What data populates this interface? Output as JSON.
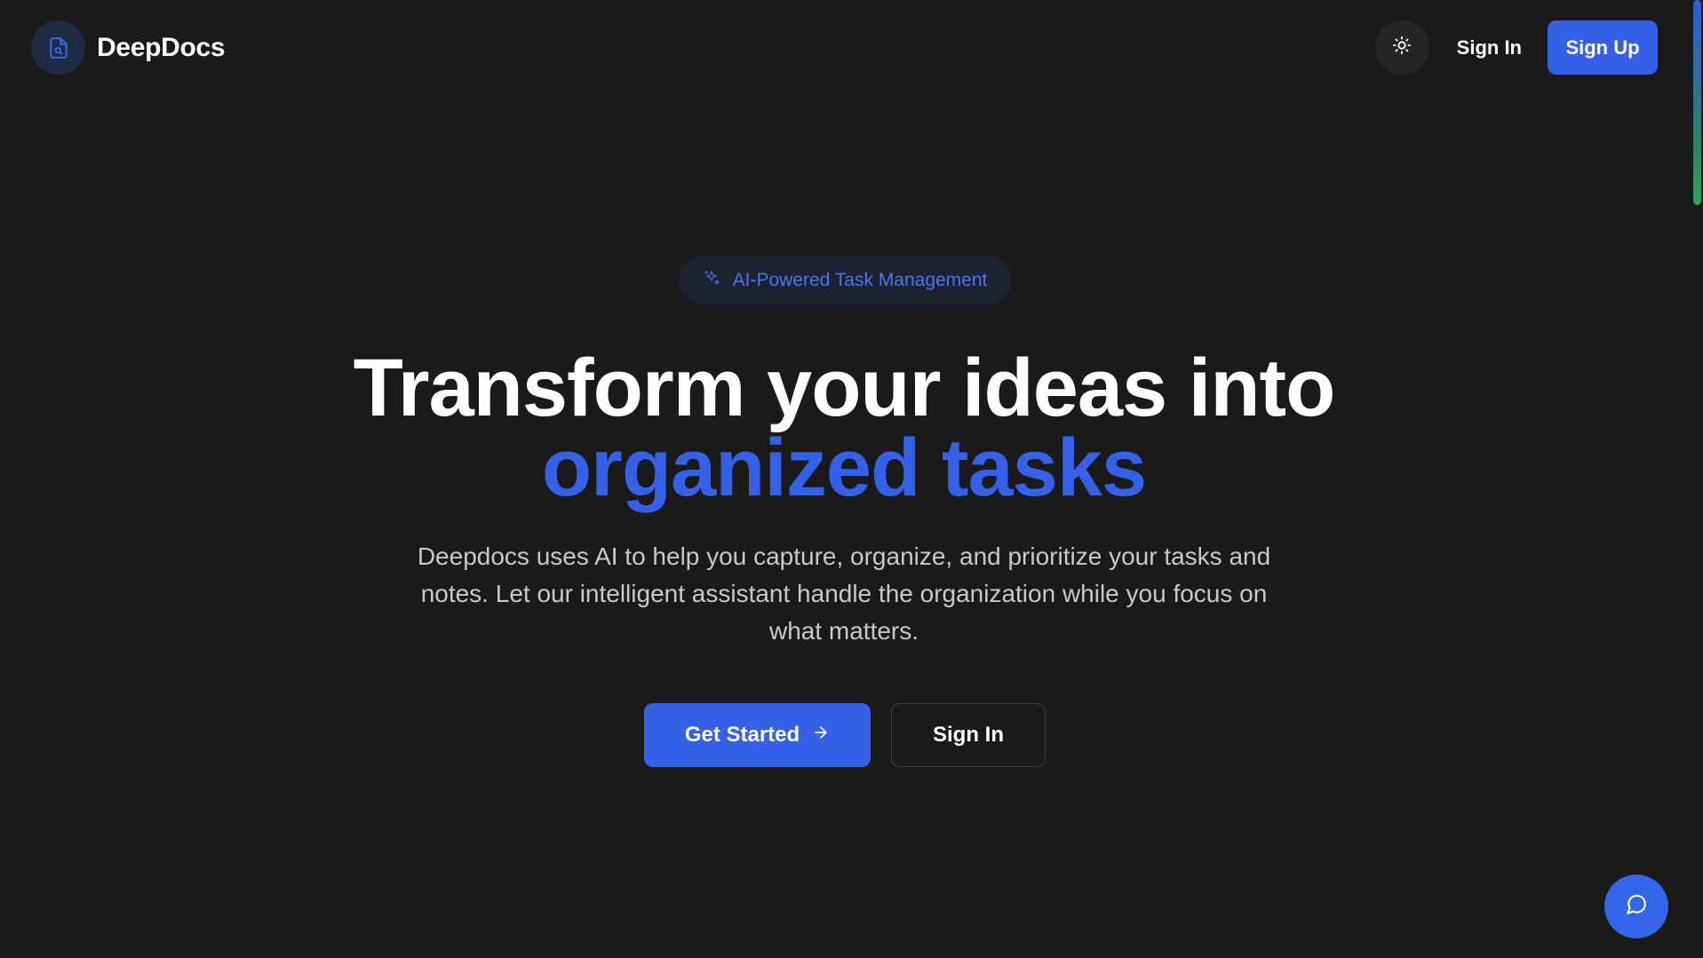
{
  "app": {
    "name": "DeepDocs"
  },
  "header": {
    "theme_toggle_icon": "sun-icon",
    "sign_in_label": "Sign In",
    "sign_up_label": "Sign Up"
  },
  "hero": {
    "badge_icon": "sparkles-icon",
    "badge_text": "AI-Powered Task Management",
    "headline_line1": "Transform your ideas into",
    "headline_line2": "organized tasks",
    "description": "Deepdocs uses AI to help you capture, organize, and prioritize your tasks and notes. Let our intelligent assistant handle the organization while you focus on what matters.",
    "primary_cta_label": "Get Started",
    "primary_cta_icon": "arrow-right-icon",
    "secondary_cta_label": "Sign In"
  },
  "chat": {
    "icon": "message-circle-icon"
  },
  "colors": {
    "background": "#1a1a1b",
    "accent": "#3461e8",
    "badge_background": "#1d2231",
    "muted_text": "#c9c9cc"
  }
}
